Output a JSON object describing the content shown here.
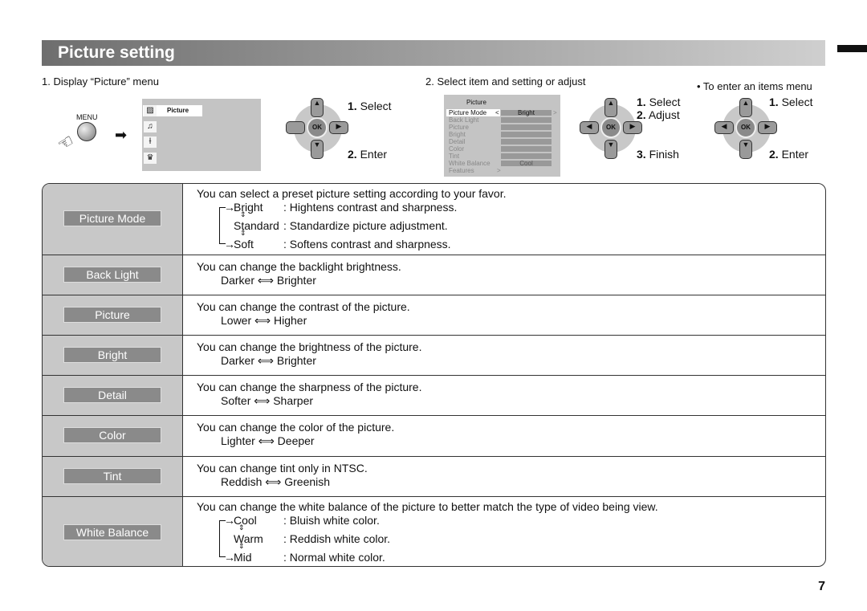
{
  "header": {
    "title": "Picture setting"
  },
  "steps": {
    "step1": "1. Display “Picture” menu",
    "step2": "2. Select item and setting or adjust",
    "step3": "• To enter an items menu"
  },
  "menu_button_label": "MENU",
  "main_menu": {
    "selected": "Picture",
    "icons": [
      "picture-icon",
      "music-icon",
      "tool-icon",
      "features-icon"
    ]
  },
  "pad1": {
    "n1": "1.",
    "l1": "Select",
    "n2": "2.",
    "l2": "Enter",
    "ok": "OK"
  },
  "pad2": {
    "n1": "1.",
    "l1": "Select",
    "n2": "2.",
    "l2": "Adjust",
    "n3": "3.",
    "l3": "Finish",
    "ok": "OK"
  },
  "pad3": {
    "n1": "1.",
    "l1": "Select",
    "n2": "2.",
    "l2": "Enter",
    "ok": "OK"
  },
  "picture_osd": {
    "title": "Picture",
    "items": [
      "Picture Mode",
      "Back Light",
      "Picture",
      "Bright",
      "Detail",
      "Color",
      "Tint",
      "White Balance",
      "Features"
    ],
    "mode_value": "Bright",
    "wb_value": "Cool",
    "left_arrow": "<",
    "right_arrow": ">",
    "features_arrow": ">"
  },
  "rows": [
    {
      "name": "Picture Mode",
      "desc": "You can select a preset picture setting according to your favor.",
      "options": [
        {
          "k": "Bright",
          "v": ":  Hightens contrast and sharpness."
        },
        {
          "k": "Standard",
          "v": ":  Standardize picture adjustment."
        },
        {
          "k": "Soft",
          "v": ":  Softens contrast and sharpness."
        }
      ]
    },
    {
      "name": "Back Light",
      "desc": "You can change the backlight brightness.",
      "range": [
        "Darker",
        "Brighter"
      ]
    },
    {
      "name": "Picture",
      "desc": "You can change the contrast of the picture.",
      "range": [
        "Lower",
        "Higher"
      ]
    },
    {
      "name": "Bright",
      "desc": "You can change the brightness of the picture.",
      "range": [
        "Darker",
        "Brighter"
      ]
    },
    {
      "name": "Detail",
      "desc": "You can change the sharpness of the picture.",
      "range": [
        "Softer",
        "Sharper"
      ]
    },
    {
      "name": "Color",
      "desc": "You can change the color of the picture.",
      "range": [
        "Lighter",
        "Deeper"
      ]
    },
    {
      "name": "Tint",
      "desc": "You can change tint only in NTSC.",
      "range": [
        "Reddish",
        "Greenish"
      ]
    },
    {
      "name": "White Balance",
      "desc": "You can change the white balance of the picture to better match the type of video being view.",
      "options": [
        {
          "k": "Cool",
          "v": ":  Bluish white color."
        },
        {
          "k": "Warm",
          "v": ":  Reddish white color."
        },
        {
          "k": "Mid",
          "v": ":  Normal white color."
        }
      ]
    }
  ],
  "page_number": "7"
}
